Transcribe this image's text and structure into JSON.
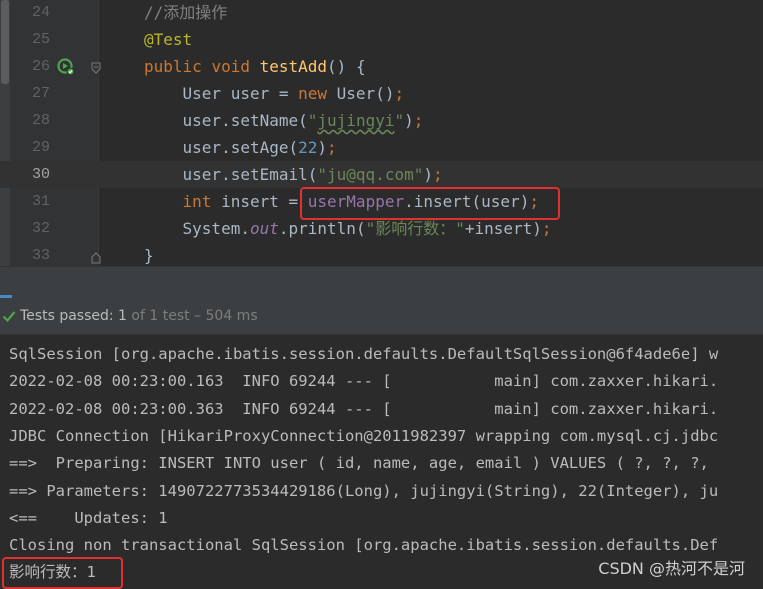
{
  "editor": {
    "lines": [
      {
        "num": "24",
        "tokens": [
          {
            "t": "//添加操作",
            "c": "cm"
          }
        ]
      },
      {
        "num": "25",
        "tokens": [
          {
            "t": "@Test",
            "c": "an"
          }
        ]
      },
      {
        "num": "26",
        "tokens": [
          {
            "t": "public ",
            "c": "kw"
          },
          {
            "t": "void ",
            "c": "kw"
          },
          {
            "t": "testAdd",
            "c": "fn"
          },
          {
            "t": "() {",
            "c": ""
          }
        ]
      },
      {
        "num": "27",
        "tokens": [
          {
            "t": "    User user = ",
            "c": ""
          },
          {
            "t": "new ",
            "c": "kw"
          },
          {
            "t": "User()",
            "c": ""
          },
          {
            "t": ";",
            "c": "kw"
          }
        ]
      },
      {
        "num": "28",
        "tokens": [
          {
            "t": "    user.setName(",
            "c": ""
          },
          {
            "t": "\"",
            "c": "str"
          },
          {
            "t": "jujingyi",
            "c": "str squig"
          },
          {
            "t": "\"",
            "c": "str"
          },
          {
            "t": ")",
            "c": ""
          },
          {
            "t": ";",
            "c": "kw"
          }
        ]
      },
      {
        "num": "29",
        "tokens": [
          {
            "t": "    user.setAge(",
            "c": ""
          },
          {
            "t": "22",
            "c": "num"
          },
          {
            "t": ")",
            "c": ""
          },
          {
            "t": ";",
            "c": "kw"
          }
        ]
      },
      {
        "num": "30",
        "current": true,
        "tokens": [
          {
            "t": "    user.setEmail(",
            "c": ""
          },
          {
            "t": "\"ju@qq.com\"",
            "c": "str"
          },
          {
            "t": ")",
            "c": ""
          },
          {
            "t": ";",
            "c": "kw"
          }
        ]
      },
      {
        "num": "31",
        "tokens": [
          {
            "t": "    ",
            "c": ""
          },
          {
            "t": "int ",
            "c": "kw"
          },
          {
            "t": "insert = ",
            "c": ""
          },
          {
            "t": "userMapper",
            "c": "fld"
          },
          {
            "t": ".insert(user)",
            "c": ""
          },
          {
            "t": ";",
            "c": "kw"
          }
        ]
      },
      {
        "num": "32",
        "tokens": [
          {
            "t": "    System.",
            "c": ""
          },
          {
            "t": "out",
            "c": "fld ital"
          },
          {
            "t": ".println(",
            "c": ""
          },
          {
            "t": "\"影响行数：\"",
            "c": "str"
          },
          {
            "t": "+insert)",
            "c": ""
          },
          {
            "t": ";",
            "c": "kw"
          }
        ]
      },
      {
        "num": "33",
        "tokens": [
          {
            "t": "}",
            "c": ""
          }
        ]
      }
    ]
  },
  "test_status": {
    "label": "Tests passed:",
    "count": "1",
    "detail": "of 1 test – 504 ms"
  },
  "console": {
    "lines": [
      "SqlSession [org.apache.ibatis.session.defaults.DefaultSqlSession@6f4ade6e] w",
      "2022-02-08 00:23:00.163  INFO 69244 --- [           main] com.zaxxer.hikari.",
      "2022-02-08 00:23:00.363  INFO 69244 --- [           main] com.zaxxer.hikari.",
      "JDBC Connection [HikariProxyConnection@2011982397 wrapping com.mysql.cj.jdbc",
      "==>  Preparing: INSERT INTO user ( id, name, age, email ) VALUES ( ?, ?, ?, ",
      "==> Parameters: 1490722773534429186(Long), jujingyi(String), 22(Integer), ju",
      "<==    Updates: 1",
      "Closing non transactional SqlSession [org.apache.ibatis.session.defaults.Def",
      "影响行数：1"
    ]
  },
  "watermark": "CSDN @热河不是河",
  "colors": {
    "highlight": "#e03030",
    "pass_green": "#4fa34f",
    "background": "#2b2b2b"
  },
  "icons": [
    "run-test-icon",
    "fold-icon",
    "check-icon"
  ]
}
